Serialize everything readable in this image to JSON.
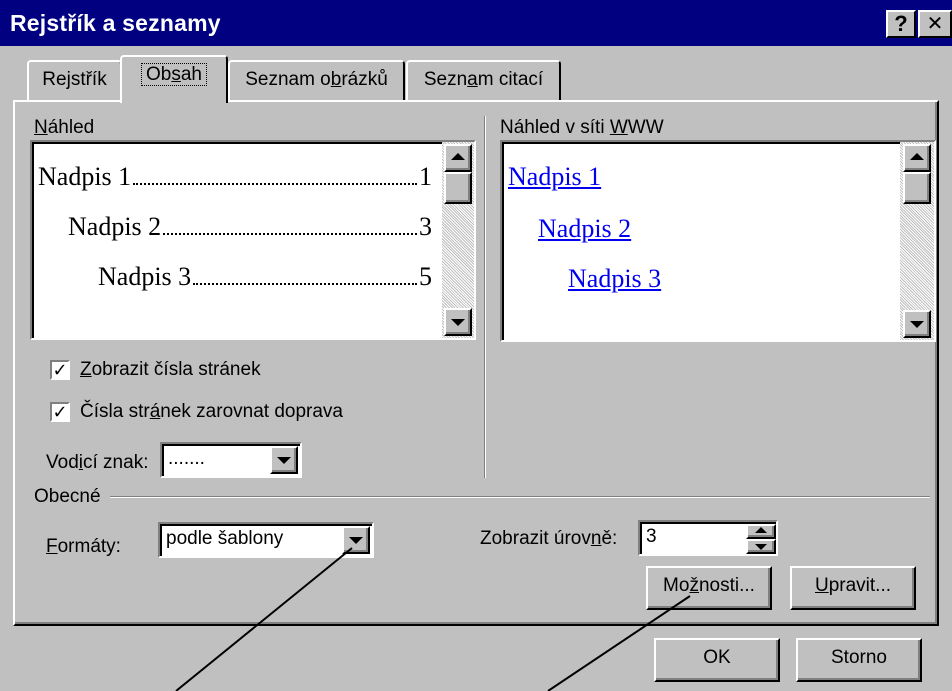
{
  "window": {
    "title": "Rejstřík a seznamy",
    "help_button": "?",
    "close_button": "✕"
  },
  "tabs": [
    {
      "label_pre": "Re",
      "label_u": "j",
      "label_post": "střík"
    },
    {
      "label_pre": "Ob",
      "label_u": "s",
      "label_post": "ah"
    },
    {
      "label_pre": "Seznam o",
      "label_u": "b",
      "label_post": "rázků"
    },
    {
      "label_pre": "Sezn",
      "label_u": "a",
      "label_post": "m citací"
    }
  ],
  "preview": {
    "label_u": "N",
    "label_post": "áhled",
    "entries": [
      {
        "text": "Nadpis 1",
        "page": "1"
      },
      {
        "text": "Nadpis 2",
        "page": "3"
      },
      {
        "text": "Nadpis 3",
        "page": "5"
      }
    ]
  },
  "web_preview": {
    "label_pre": "Náhled v síti ",
    "label_u": "W",
    "label_post": "WW",
    "entries": [
      "Nadpis 1",
      "Nadpis 2",
      "Nadpis 3"
    ]
  },
  "options": {
    "show_page_numbers": {
      "checked_mark": "✓",
      "label_u": "Z",
      "label_post": "obrazit čísla stránek"
    },
    "right_align": {
      "checked_mark": "✓",
      "label_pre": "Čísla str",
      "label_u": "á",
      "label_post": "nek zarovnat doprava"
    },
    "tab_leader": {
      "label_pre": "Vod",
      "label_u": "i",
      "label_post": "cí znak:",
      "value": "......."
    }
  },
  "general": {
    "section_label": "Obecné",
    "formats": {
      "label_u": "F",
      "label_post": "ormáty:",
      "value": "podle šablony"
    },
    "levels": {
      "label_pre": "Zobrazit úrov",
      "label_u": "n",
      "label_post": "ě:",
      "value": "3"
    }
  },
  "buttons": {
    "options": {
      "label_pre": "Mo",
      "label_u": "ž",
      "label_post": "nosti..."
    },
    "modify": {
      "label_u": "U",
      "label_post": "pravit..."
    },
    "ok": "OK",
    "cancel": "Storno"
  }
}
